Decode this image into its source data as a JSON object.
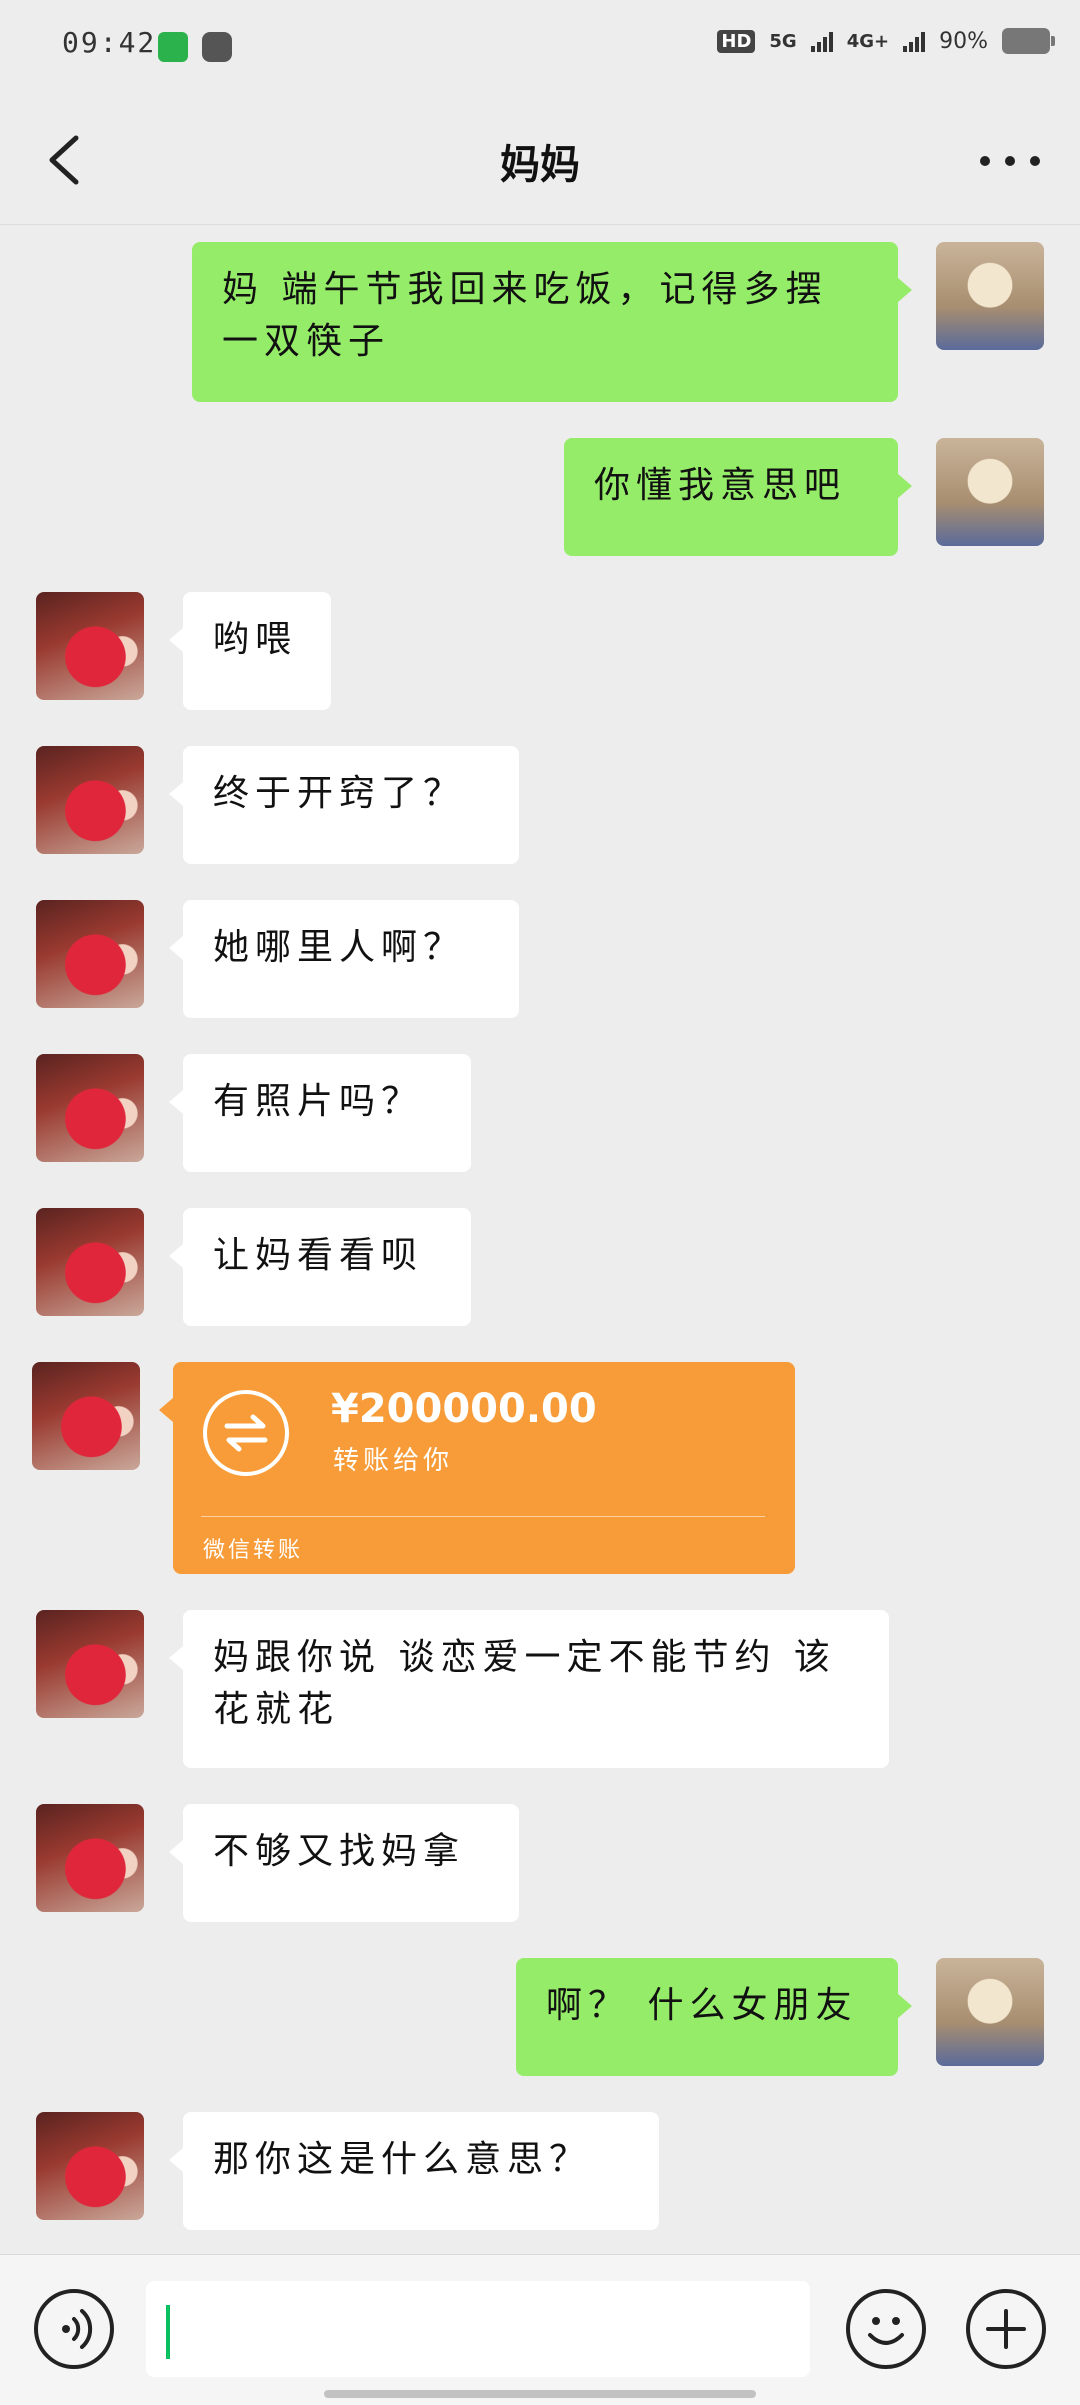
{
  "status_bar": {
    "time": "09:42",
    "hd": "HD",
    "sim1": "5G",
    "sim2": "4G+",
    "battery": "90%"
  },
  "header": {
    "title": "妈妈"
  },
  "messages": [
    {
      "from": "me",
      "text": "妈 端午节我回来吃饭，记得多摆一双筷子"
    },
    {
      "from": "me",
      "text": "你懂我意思吧"
    },
    {
      "from": "mom",
      "text": "哟喂"
    },
    {
      "from": "mom",
      "text": "终于开窍了？"
    },
    {
      "from": "mom",
      "text": "她哪里人啊？"
    },
    {
      "from": "mom",
      "text": "有照片吗？"
    },
    {
      "from": "mom",
      "text": "让妈看看呗"
    },
    {
      "from": "mom",
      "type": "transfer",
      "amount": "¥200000.00",
      "note": "转账给你",
      "footer": "微信转账"
    },
    {
      "from": "mom",
      "text": "妈跟你说 谈恋爱一定不能节约 该花就花"
    },
    {
      "from": "mom",
      "text": "不够又找妈拿"
    },
    {
      "from": "me",
      "text": "啊？ 什么女朋友"
    },
    {
      "from": "mom",
      "text": "那你这是什么意思？"
    }
  ],
  "colors": {
    "background": "#ededed",
    "outgoing_bubble": "#95ec69",
    "incoming_bubble": "#ffffff",
    "transfer_card": "#f79c39",
    "caret": "#07c160"
  },
  "icons": {
    "back": "chevron-left-icon",
    "more": "more-dots-icon",
    "voice": "voice-icon",
    "emoji": "emoji-icon",
    "plus": "plus-icon",
    "transfer": "transfer-arrows-icon"
  }
}
